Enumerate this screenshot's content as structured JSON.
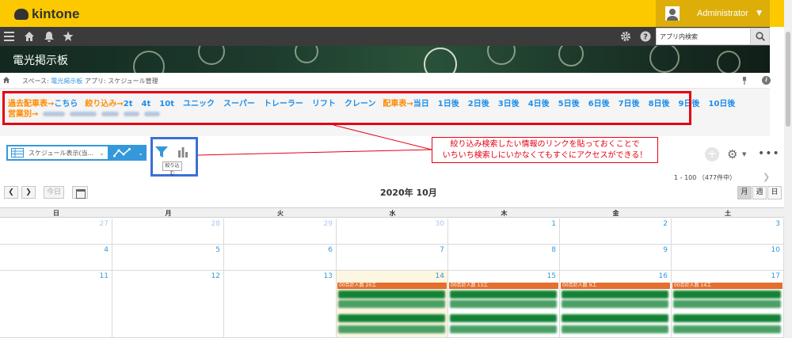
{
  "header": {
    "logo_text": "kintone",
    "user_name": "Administrator",
    "search_placeholder": "アプリ内検索"
  },
  "app": {
    "title": "電光掲示板"
  },
  "breadcrumb": {
    "space_label": "スペース: ",
    "space_name": "電光掲示板",
    "app_label": "アプリ: スケジュール管理"
  },
  "links": {
    "row1": [
      {
        "text": "過去配車表→",
        "color": "orange"
      },
      {
        "text": "こちら",
        "color": "blue"
      },
      {
        "text": "絞り込み→",
        "color": "orange"
      },
      {
        "text": "2t",
        "color": "blue"
      },
      {
        "text": "4t",
        "color": "blue"
      },
      {
        "text": "10t",
        "color": "blue"
      },
      {
        "text": "ユニック",
        "color": "blue"
      },
      {
        "text": "スーパー",
        "color": "blue"
      },
      {
        "text": "トレーラー",
        "color": "blue"
      },
      {
        "text": "リフト",
        "color": "blue"
      },
      {
        "text": "クレーン",
        "color": "blue"
      },
      {
        "text": "配車表→",
        "color": "orange"
      },
      {
        "text": "当日",
        "color": "blue"
      },
      {
        "text": "1日後",
        "color": "blue"
      },
      {
        "text": "2日後",
        "color": "blue"
      },
      {
        "text": "3日後",
        "color": "blue"
      },
      {
        "text": "4日後",
        "color": "blue"
      },
      {
        "text": "5日後",
        "color": "blue"
      },
      {
        "text": "6日後",
        "color": "blue"
      },
      {
        "text": "7日後",
        "color": "blue"
      },
      {
        "text": "8日後",
        "color": "blue"
      },
      {
        "text": "9日後",
        "color": "blue"
      },
      {
        "text": "10日後",
        "color": "blue"
      }
    ],
    "row2_label": "営業別→"
  },
  "annotation": {
    "line1": "絞り込み検索したい情報のリンクを貼っておくことで",
    "line2": "いちいち検索しにいかなくてもすぐにアクセスができる！"
  },
  "toolbar": {
    "view_name": "スケジュール表示(当...",
    "filter_tooltip": "絞り込む"
  },
  "pager": {
    "text": "1 - 100 （477件中）"
  },
  "calendar": {
    "today_label": "今日",
    "month_title": "2020年 10月",
    "mode_month": "月",
    "mode_week": "週",
    "mode_day": "日",
    "weekdays": [
      "日",
      "月",
      "火",
      "水",
      "木",
      "金",
      "土"
    ],
    "weeks": [
      [
        "27",
        "28",
        "29",
        "30",
        "1",
        "2",
        "3"
      ],
      [
        "4",
        "5",
        "6",
        "7",
        "8",
        "9",
        "10"
      ],
      [
        "11",
        "12",
        "13",
        "14",
        "15",
        "16",
        "17"
      ]
    ],
    "events": [
      {
        "day_index": 3,
        "header": "00合計人数 20工"
      },
      {
        "day_index": 4,
        "header": "00合計人数 13工"
      },
      {
        "day_index": 5,
        "header": "00合計人数 9工"
      },
      {
        "day_index": 6,
        "header": "00合計人数 14工"
      }
    ]
  },
  "colors": {
    "topbar": "#fcc800",
    "link_orange": "#ff8c00",
    "link_blue": "#1f8ee8",
    "highlight_red": "#e60012",
    "filter_box_blue": "#3c6fd6",
    "event_header": "#e46f2e",
    "event_bar": "#138234"
  }
}
